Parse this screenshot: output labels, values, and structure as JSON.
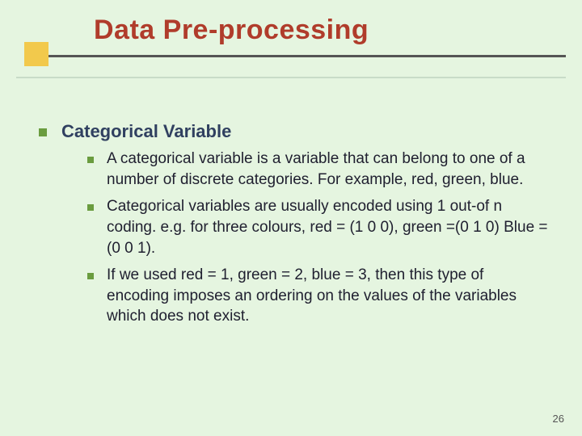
{
  "title": "Data Pre-processing",
  "heading": "Categorical Variable",
  "bullets": [
    "A categorical variable is a variable that can belong to one of a number of discrete categories. For example, red, green, blue.",
    "Categorical variables are usually encoded using 1 out-of n coding. e.g. for three colours,  red = (1 0 0), green =(0 1 0) Blue =(0 0 1).",
    "If we used red = 1, green = 2, blue = 3, then this type of encoding imposes an ordering on the values of the variables which does not exist."
  ],
  "page_number": "26"
}
